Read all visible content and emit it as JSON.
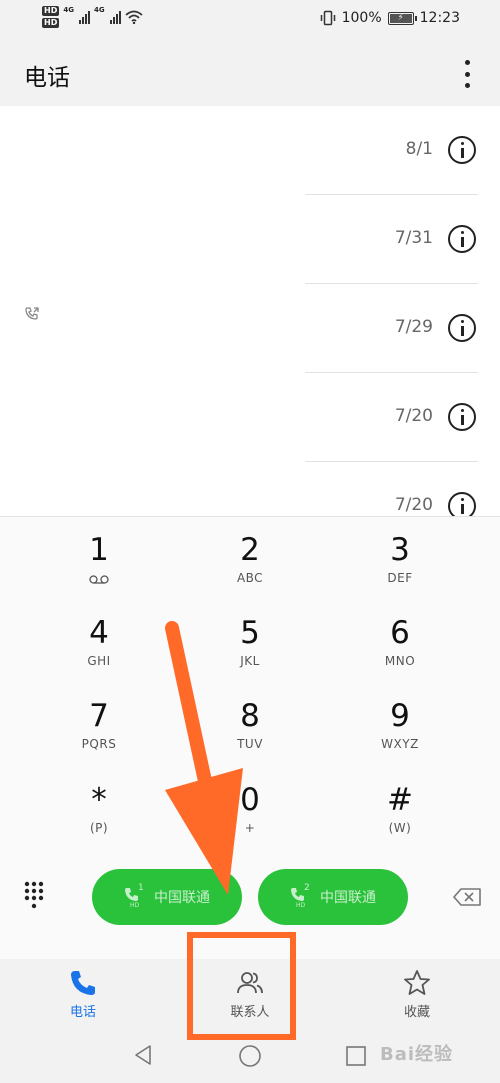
{
  "status_bar": {
    "hd1": "HD",
    "hd2": "HD",
    "net1": "4G",
    "net2": "4G",
    "battery": "100%",
    "battery_level": 1.0,
    "time": "12:23"
  },
  "header": {
    "title": "电话"
  },
  "call_log": [
    {
      "date": "8/1"
    },
    {
      "date": "7/31"
    },
    {
      "date": "7/29"
    },
    {
      "date": "7/20"
    },
    {
      "date": "7/20"
    }
  ],
  "keypad": [
    {
      "digit": "1",
      "letters": ""
    },
    {
      "digit": "2",
      "letters": "ABC"
    },
    {
      "digit": "3",
      "letters": "DEF"
    },
    {
      "digit": "4",
      "letters": "GHI"
    },
    {
      "digit": "5",
      "letters": "JKL"
    },
    {
      "digit": "6",
      "letters": "MNO"
    },
    {
      "digit": "7",
      "letters": "PQRS"
    },
    {
      "digit": "8",
      "letters": "TUV"
    },
    {
      "digit": "9",
      "letters": "WXYZ"
    },
    {
      "digit": "*",
      "letters": "(P)"
    },
    {
      "digit": "0",
      "letters": "+"
    },
    {
      "digit": "#",
      "letters": "(W)"
    }
  ],
  "call_buttons": [
    {
      "sim": "1",
      "hd": "HD",
      "carrier": "中国联通"
    },
    {
      "sim": "2",
      "hd": "HD",
      "carrier": "中国联通"
    }
  ],
  "bottom_nav": [
    {
      "label": "电话",
      "icon": "phone-icon",
      "active": true
    },
    {
      "label": "联系人",
      "icon": "contacts-icon",
      "active": false
    },
    {
      "label": "收藏",
      "icon": "star-icon",
      "active": false
    }
  ],
  "watermark": "Bai经验",
  "colors": {
    "accent": "#1a73e8",
    "call_green": "#2bc23b",
    "annotation": "#ff6a28"
  }
}
